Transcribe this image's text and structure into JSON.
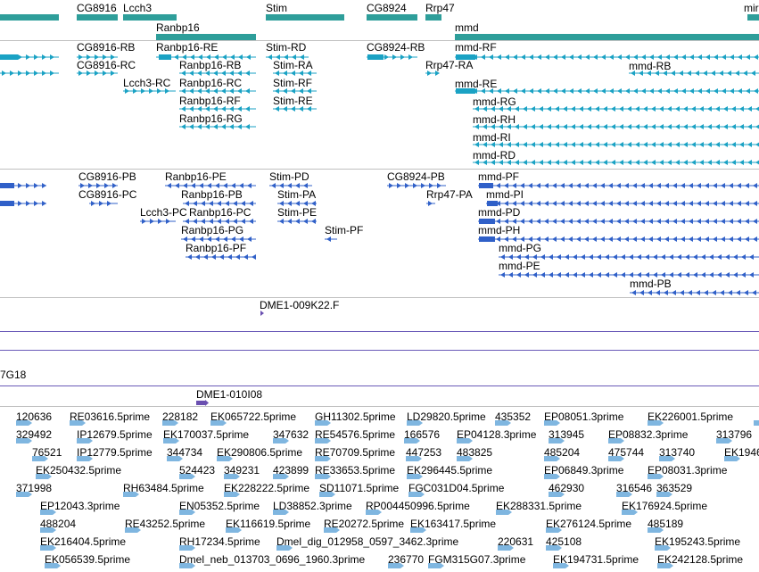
{
  "colors": {
    "gene_bar": "#2e9e9a",
    "rna_modEncode": "#1aa2c4",
    "rna_flybase": "#3060c8",
    "clone_marker": "#6a4fb0",
    "est_marker": "#7fb6e0",
    "separator_gray": "#c0c0c0",
    "separator_purple": "#6a5ab8"
  },
  "gene_track": {
    "genes": [
      "CG8916",
      "Lcch3",
      "Ranbp16",
      "Stim",
      "CG8924",
      "Rrp47",
      "mmd",
      "mir"
    ]
  },
  "transcripts_a": {
    "labels": [
      "CG8916-RB",
      "Ranbp16-RE",
      "Stim-RD",
      "CG8924-RB",
      "mmd-RF",
      "CG8916-RC",
      "Ranbp16-RB",
      "Stim-RA",
      "Rrp47-RA",
      "mmd-RB",
      "Lcch3-RC",
      "Ranbp16-RC",
      "Stim-RF",
      "mmd-RE",
      "Ranbp16-RF",
      "Stim-RE",
      "mmd-RG",
      "Ranbp16-RG",
      "mmd-RH",
      "mmd-RI",
      "mmd-RD"
    ]
  },
  "transcripts_b": {
    "labels": [
      "CG8916-PB",
      "Ranbp16-PE",
      "Stim-PD",
      "CG8924-PB",
      "mmd-PF",
      "CG8916-PC",
      "Ranbp16-PB",
      "Stim-PA",
      "Rrp47-PA",
      "mmd-PI",
      "Lcch3-PC",
      "Ranbp16-PC",
      "Stim-PE",
      "mmd-PD",
      "Ranbp16-PG",
      "Stim-PF",
      "mmd-PH",
      "Ranbp16-PF",
      "mmd-PG",
      "mmd-PE",
      "mmd-PB"
    ]
  },
  "clones": {
    "label_1": "DME1-009K22.F",
    "label_2": "7G18",
    "label_3": "DME1-010I08"
  },
  "ests": {
    "labels": [
      "120636",
      "RE03616.5prime",
      "228182",
      "EK065722.5prime",
      "GH11302.5prime",
      "LD29820.5prime",
      "435352",
      "EP08051.3prime",
      "EK226001.5prime",
      "329492",
      "IP12679.5prime",
      "EK170037.5prime",
      "347632",
      "RE54576.5prime",
      "166576",
      "EP04128.3prime",
      "313945",
      "EP08832.3prime",
      "313796",
      "76521",
      "IP12779.5prime",
      "344734",
      "EK290806.5prime",
      "RE70709.5prime",
      "447253",
      "483825",
      "485204",
      "475744",
      "313740",
      "EK1946",
      "EK250432.5prime",
      "524423",
      "349231",
      "423899",
      "RE33653.5prime",
      "EK296445.5prime",
      "EP06849.3prime",
      "EP08031.3prime",
      "371998",
      "RH63484.5prime",
      "EK228222.5prime",
      "SD11071.5prime",
      "FGC031D04.5prime",
      "462930",
      "316546",
      "363529",
      "EP12043.3prime",
      "EN05352.5prime",
      "LD38852.3prime",
      "RP004450996.5prime",
      "EK288331.5prime",
      "EK176924.5prime",
      "488204",
      "RE43252.5prime",
      "EK116619.5prime",
      "RE20272.5prime",
      "EK163417.5prime",
      "EK276124.5prime",
      "485189",
      "EK216404.5prime",
      "RH17234.5prime",
      "Dmel_dig_012958_0597_3462.3prime",
      "220631",
      "425108",
      "EK195243.5prime",
      "EK056539.5prime",
      "Dmel_neb_013703_0696_1960.3prime",
      "236770",
      "FGM315G07.3prime",
      "EK194731.5prime",
      "EK242128.5prime"
    ]
  }
}
